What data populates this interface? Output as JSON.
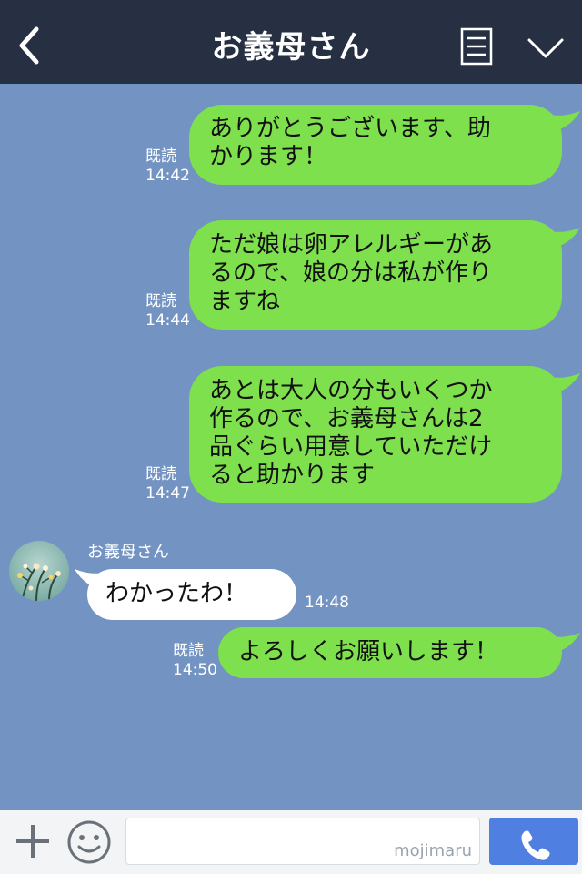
{
  "header": {
    "back_icon": "chevron-left-icon",
    "title": "お義母さん",
    "menu_icon": "list-icon",
    "dropdown_icon": "chevron-down-icon"
  },
  "messages": [
    {
      "direction": "sent",
      "lines": [
        "ありがとうございます、助",
        "かります！"
      ],
      "read": "既読",
      "time": "14:42"
    },
    {
      "direction": "sent",
      "lines": [
        "ただ娘は卵アレルギーがあ",
        "るので、娘の分は私が作り",
        "ますね"
      ],
      "read": "既読",
      "time": "14:44"
    },
    {
      "direction": "sent",
      "lines": [
        "あとは大人の分もいくつか",
        "作るので、お義母さんは2",
        "品ぐらい用意していただけ",
        "ると助かります"
      ],
      "read": "既読",
      "time": "14:47"
    },
    {
      "direction": "received",
      "sender": "お義母さん",
      "text": "わかったわ！",
      "time": "14:48"
    },
    {
      "direction": "sent",
      "text": "よろしくお願いします！",
      "read": "既読",
      "time": "14:50"
    }
  ],
  "footer": {
    "plus_icon": "plus-icon",
    "emoji_icon": "smiley-icon",
    "input_value": "",
    "watermark": "mojimaru",
    "call_icon": "phone-icon"
  },
  "colors": {
    "header_bg": "#263042",
    "chat_bg": "#7394c2",
    "sent_bubble": "#7ee04d",
    "received_bubble": "#ffffff",
    "call_button": "#4f7fe0"
  }
}
